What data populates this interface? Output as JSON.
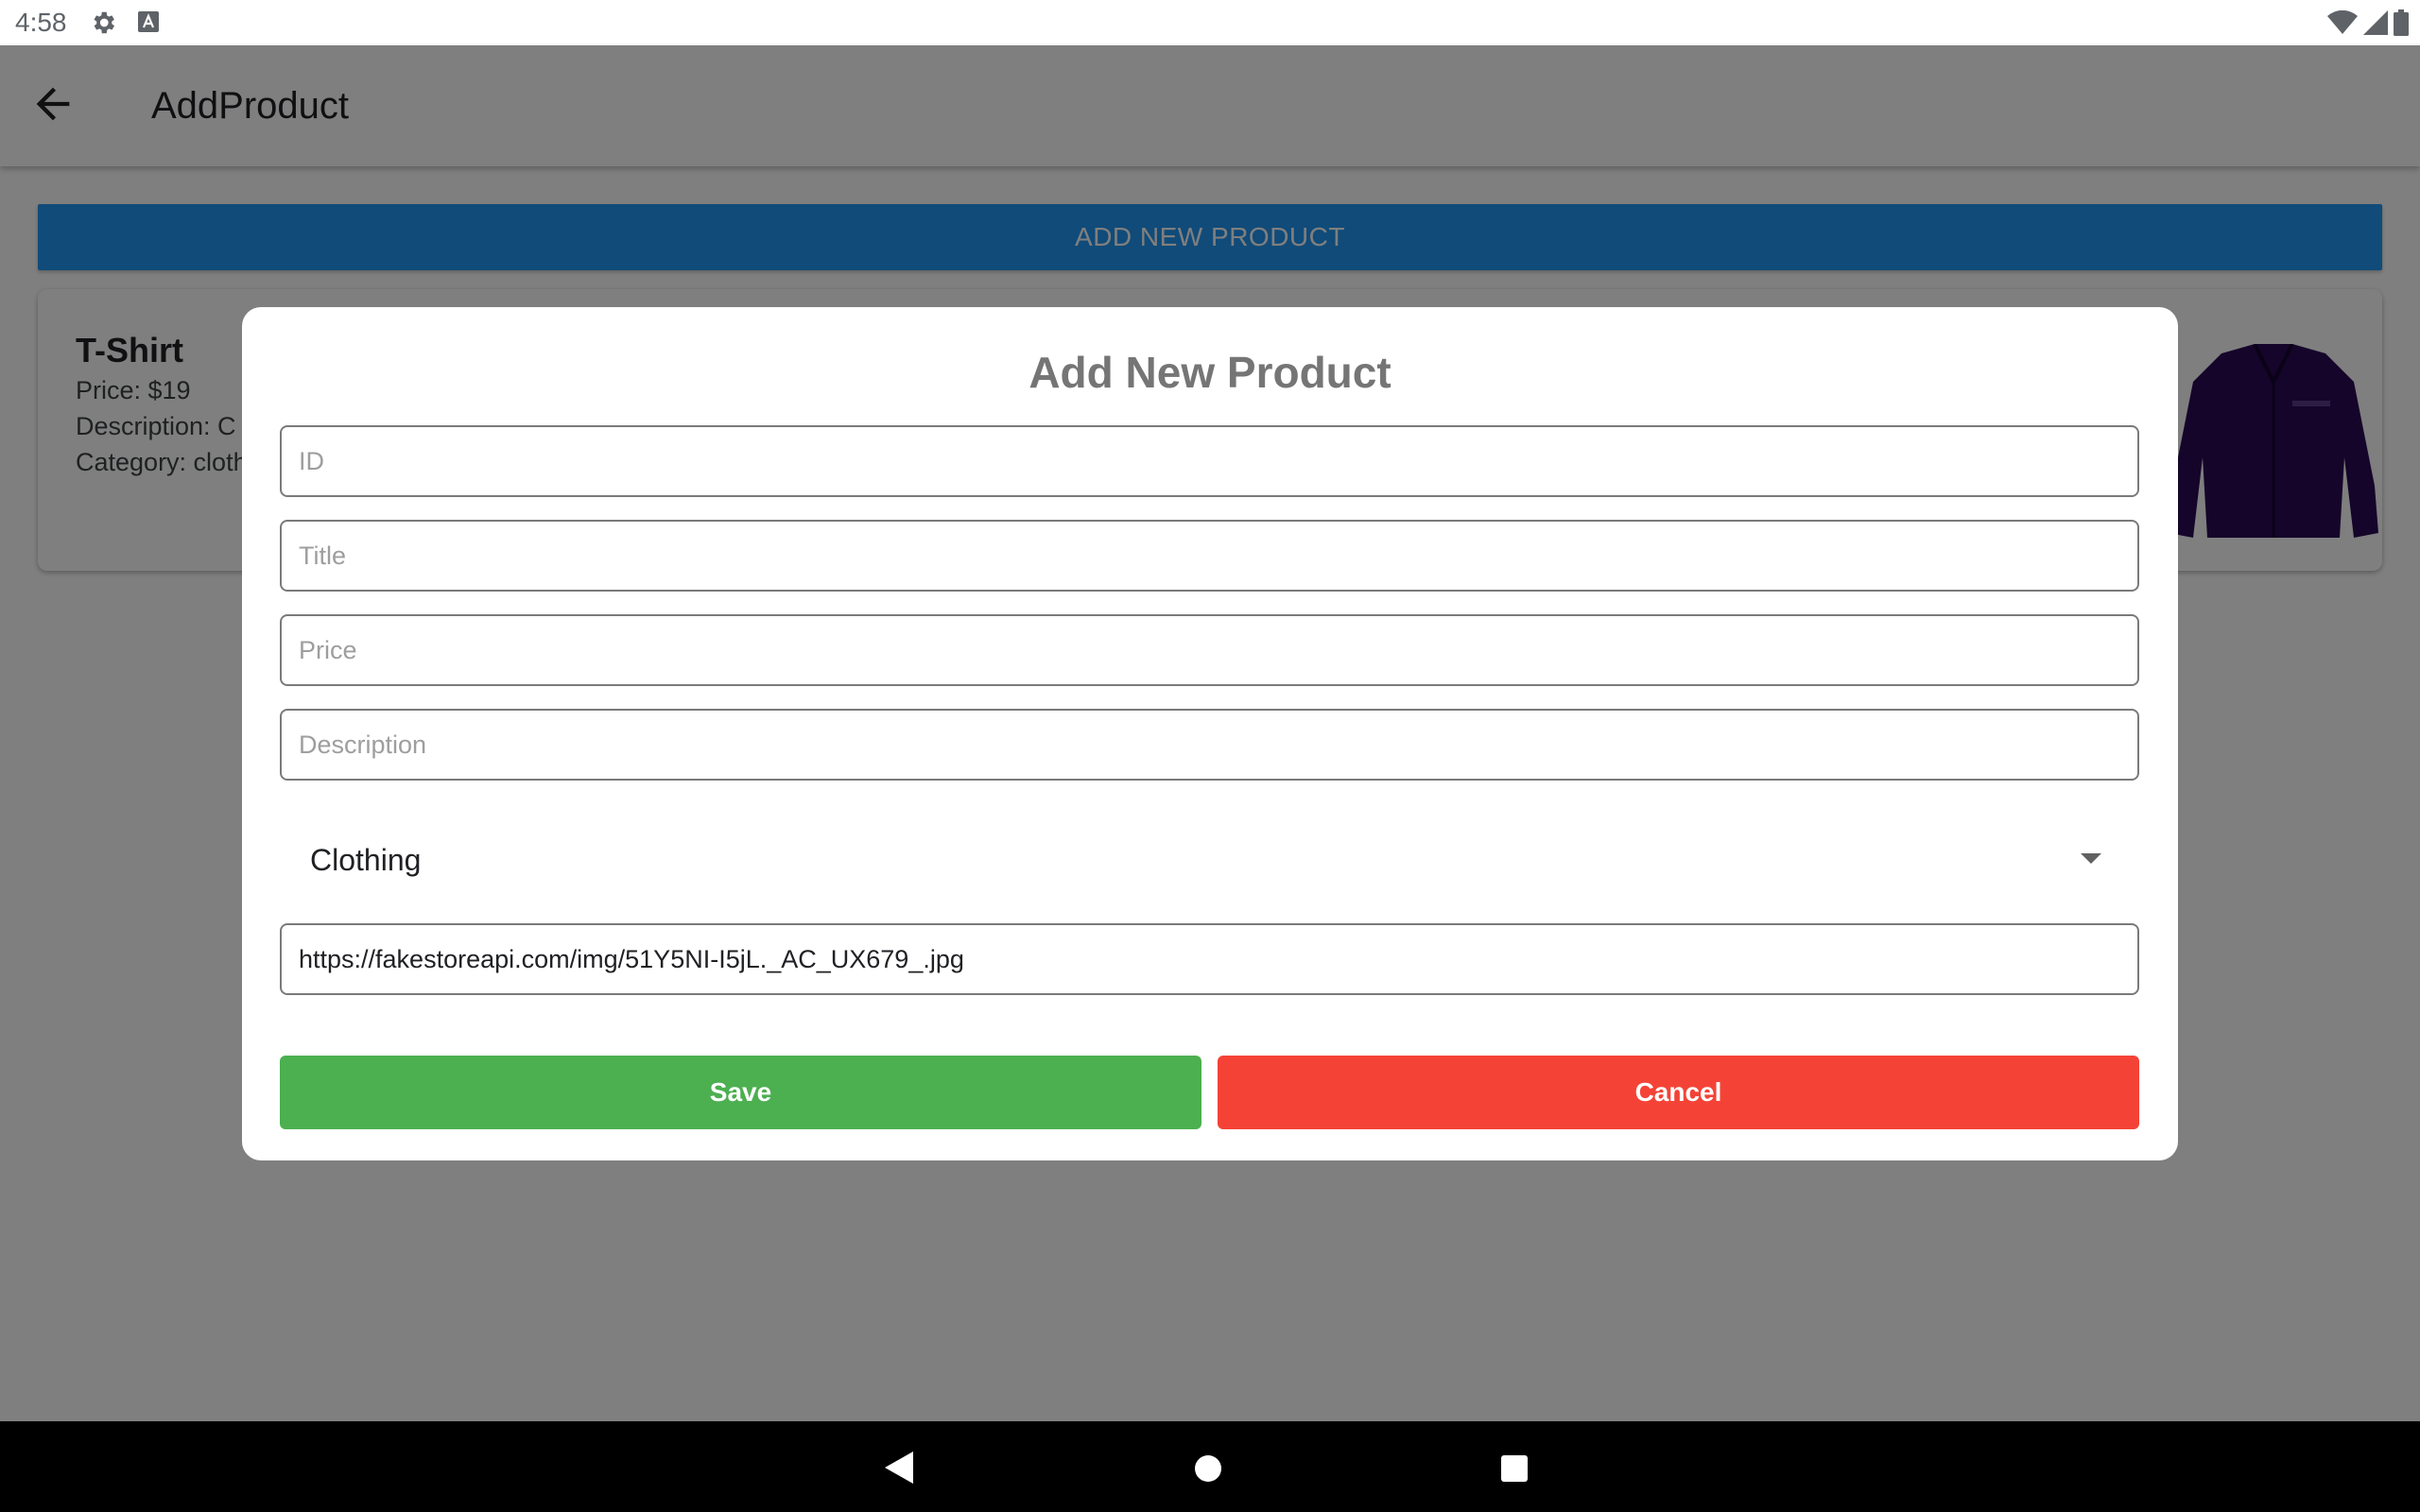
{
  "status_bar": {
    "time": "4:58",
    "icons": [
      "gear-icon",
      "a-keyboard-icon",
      "wifi-icon",
      "signal-icon",
      "battery-icon"
    ]
  },
  "app_bar": {
    "title": "AddProduct",
    "back_icon": "arrow-back-icon"
  },
  "add_new_button": {
    "label": "ADD NEW PRODUCT"
  },
  "product_card": {
    "title": "T-Shirt",
    "price": "Price: $19",
    "description": "Description: C",
    "category": "Category: cloth",
    "image_icon": "jacket-image"
  },
  "dialog": {
    "title": "Add New Product",
    "fields": {
      "id": {
        "placeholder": "ID",
        "value": ""
      },
      "title": {
        "placeholder": "Title",
        "value": ""
      },
      "price": {
        "placeholder": "Price",
        "value": ""
      },
      "description": {
        "placeholder": "Description",
        "value": ""
      },
      "image_url": {
        "placeholder": "",
        "value": "https://fakestoreapi.com/img/51Y5NI-I5jL._AC_UX679_.jpg"
      }
    },
    "category_dropdown": {
      "selected": "Clothing"
    },
    "save_label": "Save",
    "cancel_label": "Cancel"
  },
  "colors": {
    "primary": "#2196f3",
    "save": "#4caf50",
    "cancel": "#f44336"
  }
}
